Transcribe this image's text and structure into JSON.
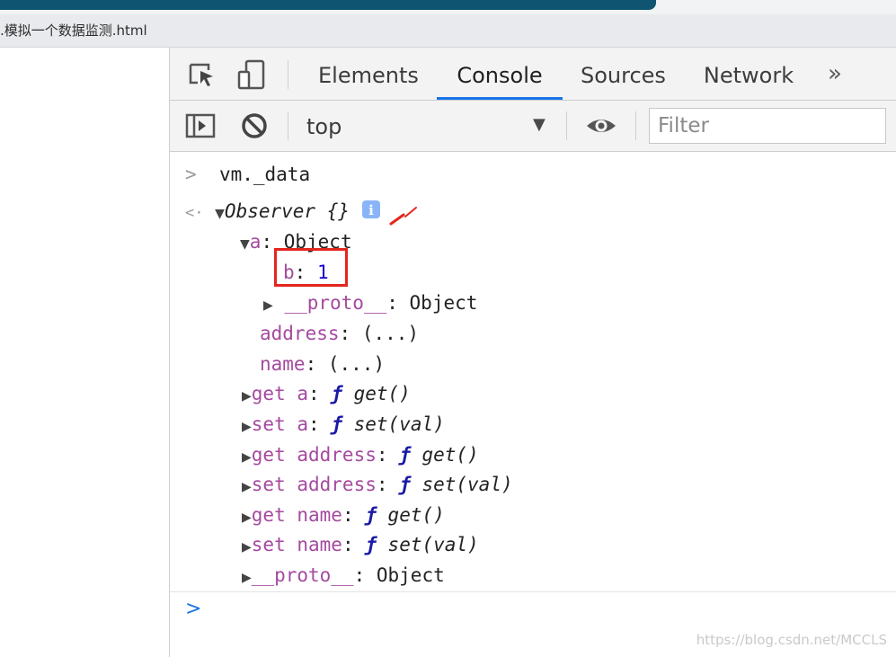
{
  "file_tab_title": ".模拟一个数据监测.html",
  "devtools": {
    "tabs": [
      {
        "label": "Elements"
      },
      {
        "label": "Console",
        "active": true
      },
      {
        "label": "Sources"
      },
      {
        "label": "Network"
      }
    ],
    "more_tabs_label": "»",
    "console_toolbar": {
      "context": "top",
      "filter_placeholder": "Filter"
    }
  },
  "console": {
    "input_command": "vm._data",
    "result": {
      "label": "Observer {}",
      "children": {
        "a_key": "a",
        "a_value": "Object",
        "b_key": "b",
        "b_value": "1",
        "proto_key": "__proto__",
        "proto_value": "Object",
        "address_key": "address",
        "address_value": "(...)",
        "name_key": "name",
        "name_value": "(...)"
      },
      "accessors": [
        {
          "key": "get a",
          "func": "get()"
        },
        {
          "key": "set a",
          "func": "set(val)"
        },
        {
          "key": "get address",
          "func": "get()"
        },
        {
          "key": "set address",
          "func": "set(val)"
        },
        {
          "key": "get name",
          "func": "get()"
        },
        {
          "key": "set name",
          "func": "set(val)"
        }
      ],
      "proto_key": "__proto__",
      "proto_value": "Object"
    },
    "f_symbol": "ƒ"
  },
  "watermark": "https://blog.csdn.net/MCCLS",
  "colors": {
    "accent": "#1a73e8",
    "highlight_box": "#e3261e",
    "property_key": "#a44a9f",
    "number": "#1c00cf"
  }
}
